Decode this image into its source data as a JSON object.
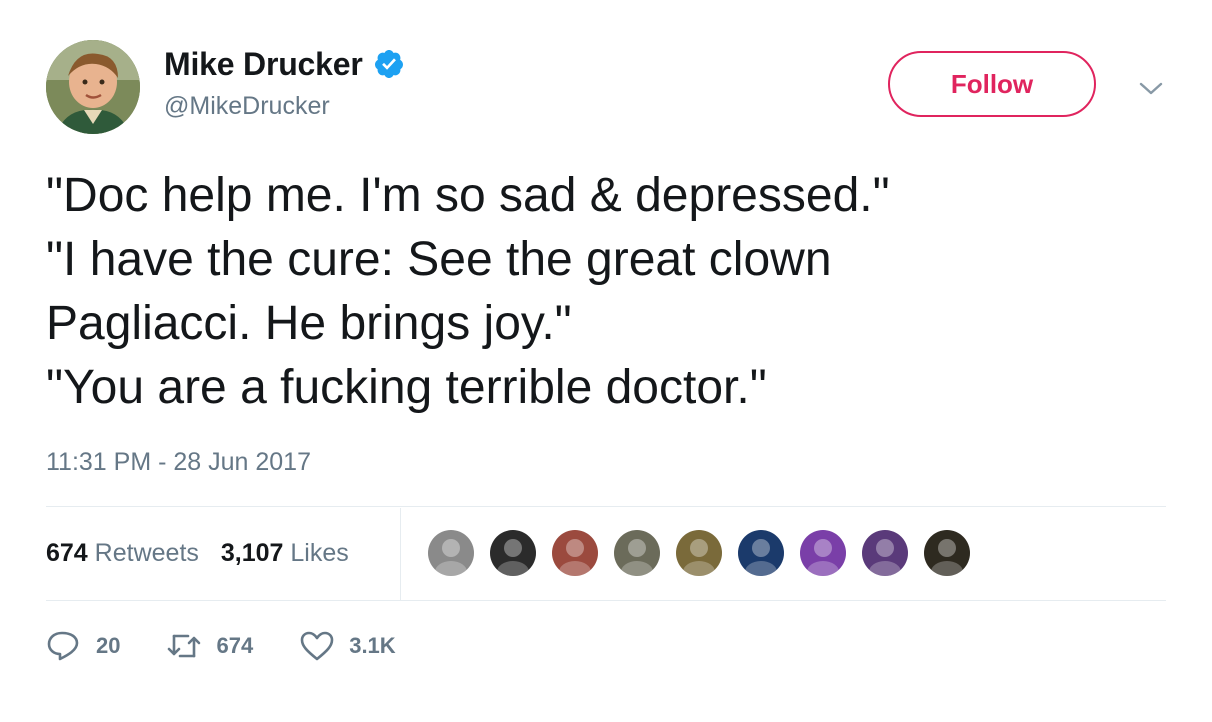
{
  "user": {
    "display_name": "Mike Drucker",
    "handle": "@MikeDrucker",
    "verified": true,
    "avatar_icon": "avatar-photo"
  },
  "follow": {
    "label": "Follow",
    "color": "#e0245e"
  },
  "tweet": {
    "lines": [
      "\"Doc help me. I'm so sad & depressed.\"",
      "\"I have the cure: See the great clown",
      "Pagliacci. He brings joy.\"",
      "\"You are a fucking terrible doctor.\""
    ],
    "timestamp": "11:31 PM - 28 Jun 2017"
  },
  "stats": {
    "retweets_count": "674",
    "retweets_label": "Retweets",
    "likes_count": "3,107",
    "likes_label": "Likes"
  },
  "likers": [
    {
      "icon": "liker-avatar-1",
      "color": "#8a8a8a"
    },
    {
      "icon": "liker-avatar-2",
      "color": "#2b2b2b"
    },
    {
      "icon": "liker-avatar-3",
      "color": "#9b4a3e"
    },
    {
      "icon": "liker-avatar-4",
      "color": "#6b6b5a"
    },
    {
      "icon": "liker-avatar-5",
      "color": "#7a6a3a"
    },
    {
      "icon": "liker-avatar-6",
      "color": "#1b3a6b"
    },
    {
      "icon": "liker-avatar-7",
      "color": "#7a3fa8"
    },
    {
      "icon": "liker-avatar-8",
      "color": "#5a3a7a"
    },
    {
      "icon": "liker-avatar-9",
      "color": "#2e2a20"
    }
  ],
  "actions": {
    "replies": "20",
    "retweets": "674",
    "likes": "3.1K"
  },
  "colors": {
    "text": "#14171a",
    "muted": "#657786",
    "verified": "#1da1f2",
    "divider": "#e6ecf0"
  }
}
